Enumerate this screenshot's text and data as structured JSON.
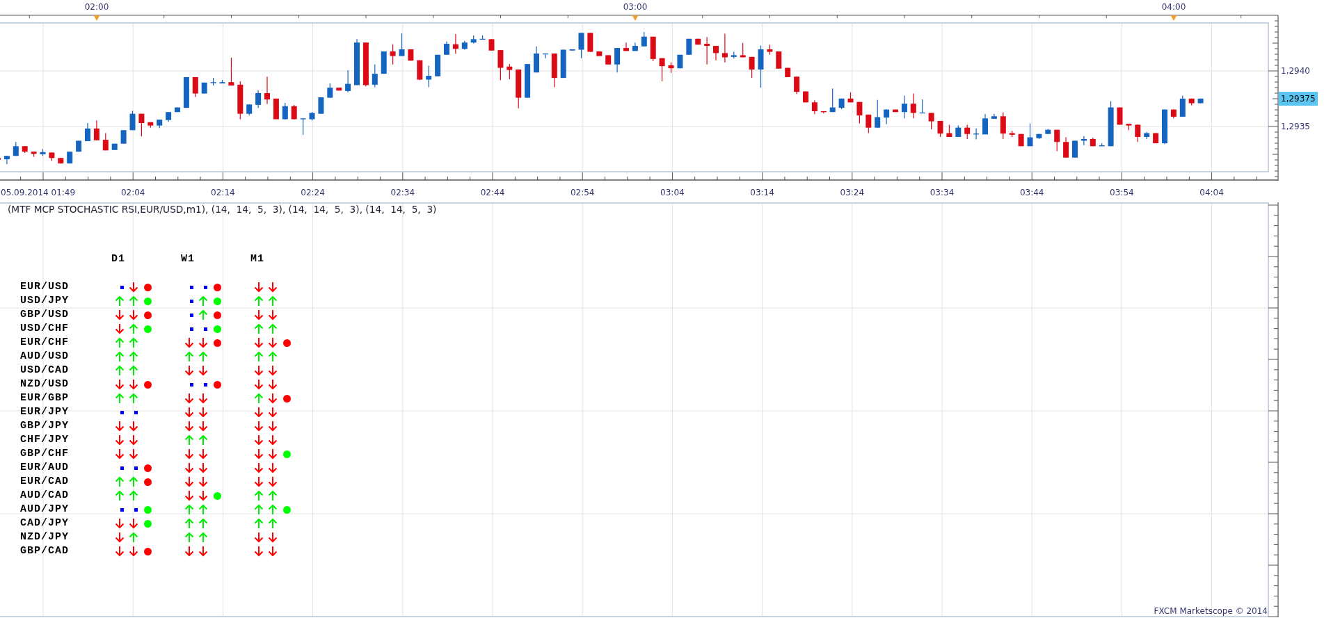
{
  "chart": {
    "hour_labels": [
      "02:00",
      "03:00",
      "04:00"
    ],
    "time_labels": [
      "05.09.2014 01:49",
      "02:04",
      "02:14",
      "02:24",
      "02:34",
      "02:44",
      "02:54",
      "03:04",
      "03:14",
      "03:24",
      "03:34",
      "03:44",
      "03:54",
      "04:04"
    ],
    "price_labels": [
      "1,2940",
      "1,2935"
    ],
    "current_price": "1,29375"
  },
  "indicator": {
    "title": "(MTF MCP STOCHASTIC RSI,EUR/USD,m1), (14,  14,  5,  3), (14,  14,  5,  3), (14,  14,  5,  3)",
    "columns": [
      "D1",
      "W1",
      "M1"
    ],
    "rows": [
      {
        "pair": "EUR/USD",
        "cells": [
          {
            "marks": [
              {
                "kind": "flat"
              },
              {
                "kind": "down"
              }
            ],
            "color": "#ff0000"
          },
          {
            "marks": [
              {
                "kind": "flat"
              },
              {
                "kind": "flat"
              }
            ],
            "color": "#ff0000"
          },
          {
            "marks": [
              {
                "kind": "down"
              },
              {
                "kind": "down"
              }
            ]
          }
        ]
      },
      {
        "pair": "USD/JPY",
        "cells": [
          {
            "marks": [
              {
                "kind": "up"
              },
              {
                "kind": "up"
              }
            ],
            "color": "#00ff00"
          },
          {
            "marks": [
              {
                "kind": "flat"
              },
              {
                "kind": "up"
              }
            ],
            "color": "#00ff00"
          },
          {
            "marks": [
              {
                "kind": "up"
              },
              {
                "kind": "up"
              }
            ]
          }
        ]
      },
      {
        "pair": "GBP/USD",
        "cells": [
          {
            "marks": [
              {
                "kind": "down"
              },
              {
                "kind": "down"
              }
            ],
            "color": "#ff0000"
          },
          {
            "marks": [
              {
                "kind": "flat"
              },
              {
                "kind": "up"
              }
            ],
            "color": "#ff0000"
          },
          {
            "marks": [
              {
                "kind": "down"
              },
              {
                "kind": "down"
              }
            ]
          }
        ]
      },
      {
        "pair": "USD/CHF",
        "cells": [
          {
            "marks": [
              {
                "kind": "down"
              },
              {
                "kind": "up"
              }
            ],
            "color": "#00ff00"
          },
          {
            "marks": [
              {
                "kind": "flat"
              },
              {
                "kind": "flat"
              }
            ],
            "color": "#00ff00"
          },
          {
            "marks": [
              {
                "kind": "up"
              },
              {
                "kind": "up"
              }
            ]
          }
        ]
      },
      {
        "pair": "EUR/CHF",
        "cells": [
          {
            "marks": [
              {
                "kind": "up"
              },
              {
                "kind": "up"
              }
            ]
          },
          {
            "marks": [
              {
                "kind": "down"
              },
              {
                "kind": "down"
              }
            ],
            "color": "#ff0000"
          },
          {
            "marks": [
              {
                "kind": "down"
              },
              {
                "kind": "down"
              }
            ],
            "color": "#ff0000"
          }
        ]
      },
      {
        "pair": "AUD/USD",
        "cells": [
          {
            "marks": [
              {
                "kind": "up"
              },
              {
                "kind": "up"
              }
            ]
          },
          {
            "marks": [
              {
                "kind": "up"
              },
              {
                "kind": "up"
              }
            ]
          },
          {
            "marks": [
              {
                "kind": "up"
              },
              {
                "kind": "up"
              }
            ]
          }
        ]
      },
      {
        "pair": "USD/CAD",
        "cells": [
          {
            "marks": [
              {
                "kind": "up"
              },
              {
                "kind": "up"
              }
            ]
          },
          {
            "marks": [
              {
                "kind": "down"
              },
              {
                "kind": "down"
              }
            ]
          },
          {
            "marks": [
              {
                "kind": "down"
              },
              {
                "kind": "down"
              }
            ]
          }
        ]
      },
      {
        "pair": "NZD/USD",
        "cells": [
          {
            "marks": [
              {
                "kind": "down"
              },
              {
                "kind": "down"
              }
            ],
            "color": "#ff0000"
          },
          {
            "marks": [
              {
                "kind": "flat"
              },
              {
                "kind": "flat"
              }
            ],
            "color": "#ff0000"
          },
          {
            "marks": [
              {
                "kind": "down"
              },
              {
                "kind": "down"
              }
            ]
          }
        ]
      },
      {
        "pair": "EUR/GBP",
        "cells": [
          {
            "marks": [
              {
                "kind": "up"
              },
              {
                "kind": "up"
              }
            ]
          },
          {
            "marks": [
              {
                "kind": "down"
              },
              {
                "kind": "down"
              }
            ]
          },
          {
            "marks": [
              {
                "kind": "up"
              },
              {
                "kind": "down"
              }
            ],
            "color": "#ff0000"
          }
        ]
      },
      {
        "pair": "EUR/JPY",
        "cells": [
          {
            "marks": [
              {
                "kind": "flat"
              },
              {
                "kind": "flat"
              }
            ]
          },
          {
            "marks": [
              {
                "kind": "down"
              },
              {
                "kind": "down"
              }
            ]
          },
          {
            "marks": [
              {
                "kind": "down"
              },
              {
                "kind": "down"
              }
            ]
          }
        ]
      },
      {
        "pair": "GBP/JPY",
        "cells": [
          {
            "marks": [
              {
                "kind": "down"
              },
              {
                "kind": "down"
              }
            ]
          },
          {
            "marks": [
              {
                "kind": "down"
              },
              {
                "kind": "down"
              }
            ]
          },
          {
            "marks": [
              {
                "kind": "down"
              },
              {
                "kind": "down"
              }
            ]
          }
        ]
      },
      {
        "pair": "CHF/JPY",
        "cells": [
          {
            "marks": [
              {
                "kind": "down"
              },
              {
                "kind": "down"
              }
            ]
          },
          {
            "marks": [
              {
                "kind": "up"
              },
              {
                "kind": "up"
              }
            ]
          },
          {
            "marks": [
              {
                "kind": "down"
              },
              {
                "kind": "down"
              }
            ]
          }
        ]
      },
      {
        "pair": "GBP/CHF",
        "cells": [
          {
            "marks": [
              {
                "kind": "down"
              },
              {
                "kind": "down"
              }
            ]
          },
          {
            "marks": [
              {
                "kind": "down"
              },
              {
                "kind": "down"
              }
            ]
          },
          {
            "marks": [
              {
                "kind": "down"
              },
              {
                "kind": "down"
              }
            ],
            "color": "#00ff00"
          }
        ]
      },
      {
        "pair": "EUR/AUD",
        "cells": [
          {
            "marks": [
              {
                "kind": "flat"
              },
              {
                "kind": "flat"
              }
            ],
            "color": "#ff0000"
          },
          {
            "marks": [
              {
                "kind": "down"
              },
              {
                "kind": "down"
              }
            ]
          },
          {
            "marks": [
              {
                "kind": "down"
              },
              {
                "kind": "down"
              }
            ]
          }
        ]
      },
      {
        "pair": "EUR/CAD",
        "cells": [
          {
            "marks": [
              {
                "kind": "up"
              },
              {
                "kind": "up"
              }
            ],
            "color": "#ff0000"
          },
          {
            "marks": [
              {
                "kind": "down"
              },
              {
                "kind": "down"
              }
            ]
          },
          {
            "marks": [
              {
                "kind": "down"
              },
              {
                "kind": "down"
              }
            ]
          }
        ]
      },
      {
        "pair": "AUD/CAD",
        "cells": [
          {
            "marks": [
              {
                "kind": "up"
              },
              {
                "kind": "up"
              }
            ]
          },
          {
            "marks": [
              {
                "kind": "down"
              },
              {
                "kind": "down"
              }
            ],
            "color": "#00ff00"
          },
          {
            "marks": [
              {
                "kind": "up"
              },
              {
                "kind": "up"
              }
            ]
          }
        ]
      },
      {
        "pair": "AUD/JPY",
        "cells": [
          {
            "marks": [
              {
                "kind": "flat"
              },
              {
                "kind": "flat"
              }
            ],
            "color": "#00ff00"
          },
          {
            "marks": [
              {
                "kind": "up"
              },
              {
                "kind": "up"
              }
            ]
          },
          {
            "marks": [
              {
                "kind": "up"
              },
              {
                "kind": "up"
              }
            ],
            "color": "#00ff00"
          }
        ]
      },
      {
        "pair": "CAD/JPY",
        "cells": [
          {
            "marks": [
              {
                "kind": "down"
              },
              {
                "kind": "down"
              }
            ],
            "color": "#00ff00"
          },
          {
            "marks": [
              {
                "kind": "up"
              },
              {
                "kind": "up"
              }
            ]
          },
          {
            "marks": [
              {
                "kind": "up"
              },
              {
                "kind": "up"
              }
            ]
          }
        ]
      },
      {
        "pair": "NZD/JPY",
        "cells": [
          {
            "marks": [
              {
                "kind": "down"
              },
              {
                "kind": "up"
              }
            ]
          },
          {
            "marks": [
              {
                "kind": "up"
              },
              {
                "kind": "up"
              }
            ]
          },
          {
            "marks": [
              {
                "kind": "down"
              },
              {
                "kind": "down"
              }
            ]
          }
        ]
      },
      {
        "pair": "GBP/CAD",
        "cells": [
          {
            "marks": [
              {
                "kind": "down"
              },
              {
                "kind": "down"
              }
            ],
            "color": "#ff0000"
          },
          {
            "marks": [
              {
                "kind": "down"
              },
              {
                "kind": "down"
              }
            ]
          },
          {
            "marks": [
              {
                "kind": "down"
              },
              {
                "kind": "down"
              }
            ]
          }
        ]
      }
    ]
  },
  "footer": {
    "copyright": "FXCM Marketscope © 2014"
  }
}
